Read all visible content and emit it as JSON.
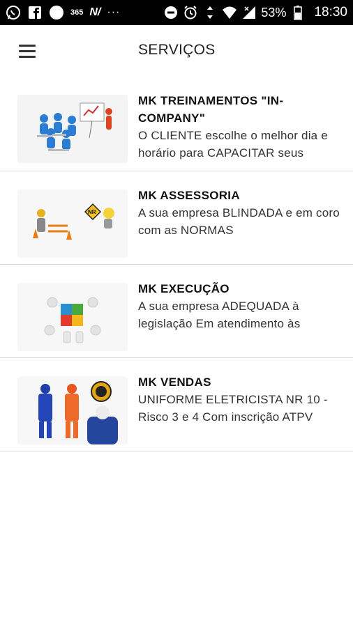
{
  "status_bar": {
    "icons": [
      "whatsapp-icon",
      "facebook-icon",
      "circle-icon",
      "365-icon",
      "nv-icon",
      "more-dots-icon",
      "dnd-icon",
      "alarm-icon",
      "data-arrows-icon",
      "wifi-icon",
      "signal-icon",
      "battery-icon"
    ],
    "app365": "365",
    "nv": "N/",
    "dots": "···",
    "battery_percent": "53%",
    "time": "18:30"
  },
  "app_bar": {
    "title": "SERVIÇOS"
  },
  "services": [
    {
      "title": "MK TREINAMENTOS \"IN-COMPANY\"",
      "description": "O CLIENTE escolhe o melhor dia e horário para CAPACITAR seus",
      "thumbnail": "training-presentation-image"
    },
    {
      "title": "MK ASSESSORIA",
      "description": "A sua empresa BLINDADA e em coro com as NORMAS",
      "thumbnail": "construction-nr-image"
    },
    {
      "title": "MK EXECUÇÃO",
      "description": "A sua empresa ADEQUADA à legislação  Em atendimento às",
      "thumbnail": "puzzle-team-image"
    },
    {
      "title": "MK VENDAS",
      "description": "UNIFORME ELETRICISTA NR 10 - Risco 3 e 4 Com inscrição ATPV",
      "thumbnail": "uniforms-image"
    }
  ],
  "colors": {
    "status_bar_bg": "#000000",
    "background": "#ffffff",
    "divider": "#d8d8d8"
  }
}
